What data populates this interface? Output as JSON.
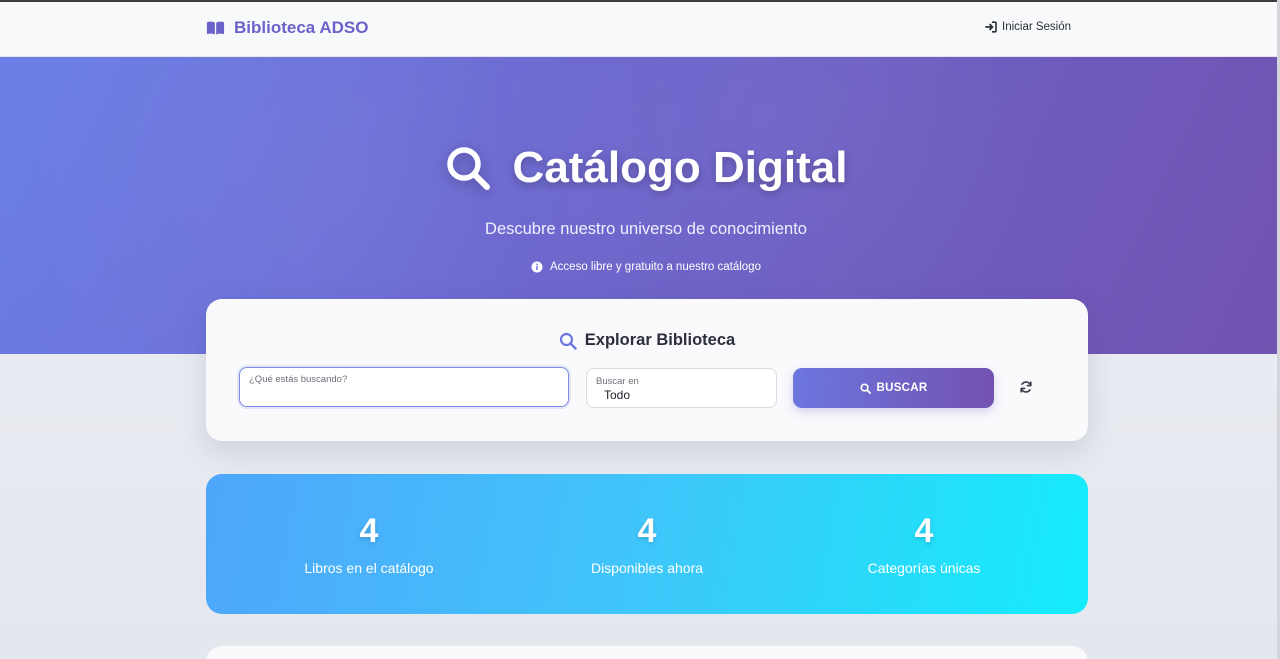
{
  "navbar": {
    "brand": "Biblioteca ADSO",
    "login": "Iniciar Sesión"
  },
  "hero": {
    "title": "Catálogo Digital",
    "subtitle": "Descubre nuestro universo de conocimiento",
    "note": "Acceso libre y gratuito a nuestro catálogo"
  },
  "search": {
    "title": "Explorar Biblioteca",
    "query_label": "¿Qué estás buscando?",
    "query_value": "",
    "filter_label": "Buscar en",
    "filter_value": "Todo",
    "button": "BUSCAR"
  },
  "stats": [
    {
      "value": "4",
      "label": "Libros en el catálogo"
    },
    {
      "value": "4",
      "label": "Disponibles ahora"
    },
    {
      "value": "4",
      "label": "Categorías únicas"
    }
  ],
  "colors": {
    "brand": "#6a62c9",
    "hero_start": "#6a7fe6",
    "hero_end": "#7153b0",
    "stats_start": "#4fa6fb",
    "stats_end": "#14ecfb"
  },
  "icons": {
    "brand": "book-open-icon",
    "login": "sign-in-icon",
    "hero": "search-icon",
    "note": "info-circle-icon",
    "card": "search-icon",
    "button": "search-icon",
    "reset": "refresh-icon"
  }
}
